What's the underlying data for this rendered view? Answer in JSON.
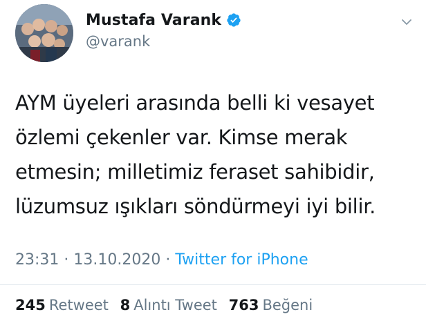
{
  "author": {
    "display_name": "Mustafa Varank",
    "handle": "@varank",
    "verified": true,
    "avatar_icon": "profile-photo-group"
  },
  "tweet": {
    "text": "AYM üyeleri arasında belli ki vesayet\nözlemi çekenler var. Kimse merak\netmesin; milletimiz feraset sahibidir,\nlüzumsuz ışıkları söndürmeyi iyi bilir."
  },
  "meta": {
    "time": "23:31",
    "separator": "·",
    "date": "13.10.2020",
    "source": "Twitter for iPhone"
  },
  "stats": {
    "retweets_count": "245",
    "retweets_label": "Retweet",
    "quotes_count": "8",
    "quotes_label": "Alıntı Tweet",
    "likes_count": "763",
    "likes_label": "Beğeni"
  },
  "colors": {
    "accent": "#1da1f2",
    "secondary_text": "#657786",
    "primary_text": "#14171a"
  },
  "icons": {
    "verified": "verified-badge-icon",
    "more": "chevron-down-icon"
  }
}
